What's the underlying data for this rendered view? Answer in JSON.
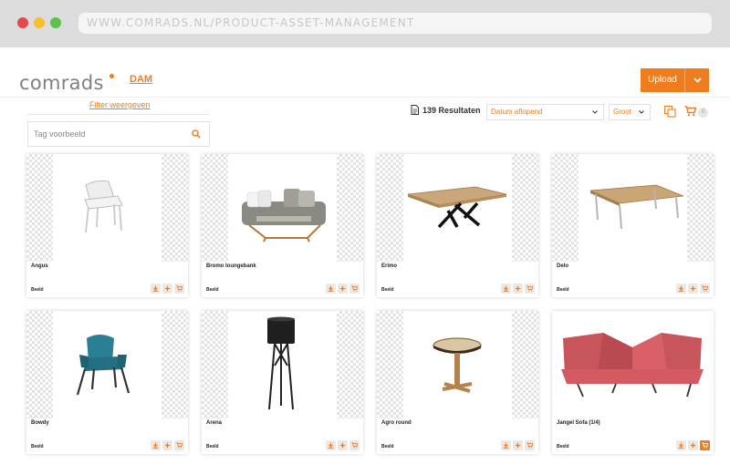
{
  "browser": {
    "url": "WWW.COMRADS.NL/PRODUCT-ASSET-MANAGEMENT"
  },
  "header": {
    "logo": "comrads",
    "nav_dam": "DAM",
    "upload_label": "Upload"
  },
  "filters": {
    "toggle_label": "Filter weergeven",
    "tag_placeholder": "Tag voorbeeld"
  },
  "toolbar": {
    "results_label": "139 Resultaten",
    "sort_value": "Datum aflopend",
    "size_value": "Groot",
    "cart_count": "0"
  },
  "colors": {
    "accent": "#f07d1d"
  },
  "products": [
    {
      "name": "Angus",
      "type": "Beeld",
      "in_cart": false,
      "image": "white-chair"
    },
    {
      "name": "Bromo loungebank",
      "type": "Beeld",
      "in_cart": false,
      "image": "lounge-sofa"
    },
    {
      "name": "Erimo",
      "type": "Beeld",
      "in_cart": false,
      "image": "wood-table-x-base"
    },
    {
      "name": "Delo",
      "type": "Beeld",
      "in_cart": false,
      "image": "wood-table-metal-legs"
    },
    {
      "name": "Bowdy",
      "type": "Beeld",
      "in_cart": false,
      "image": "teal-armchair"
    },
    {
      "name": "Arena",
      "type": "Beeld",
      "in_cart": false,
      "image": "floor-lamp"
    },
    {
      "name": "Agro round",
      "type": "Beeld",
      "in_cart": false,
      "image": "round-side-table"
    },
    {
      "name": "Jangel Sofa (1/4)",
      "type": "Beeld",
      "in_cart": true,
      "image": "red-sofa"
    }
  ]
}
